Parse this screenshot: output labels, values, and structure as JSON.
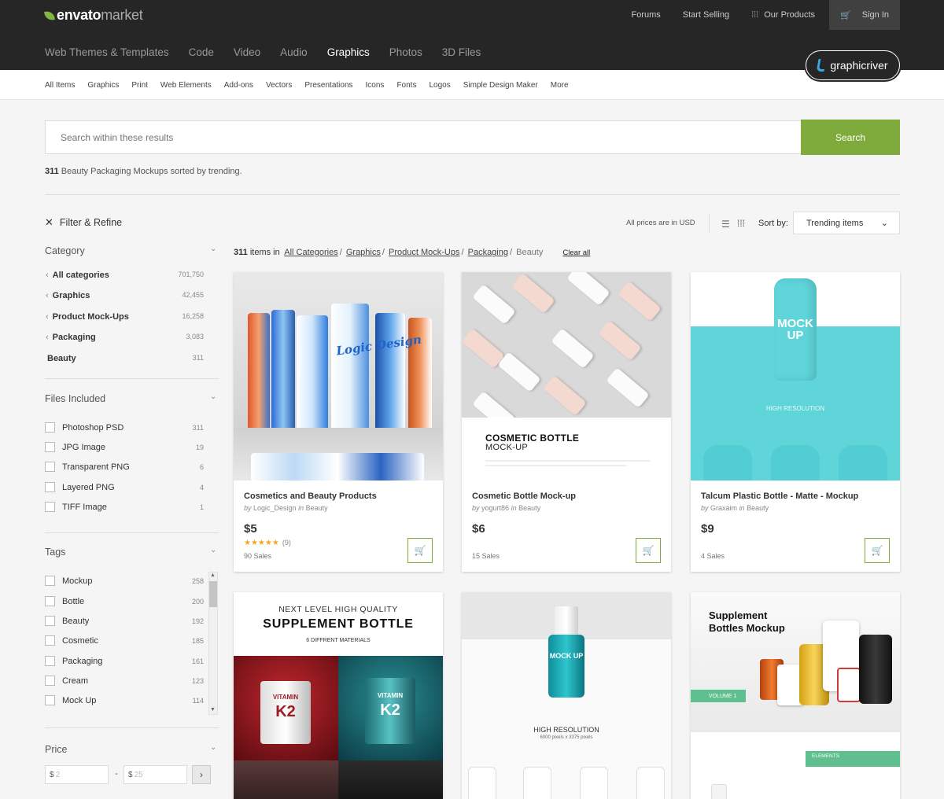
{
  "brand": {
    "word1": "envato",
    "word2": "market"
  },
  "top_links": {
    "forums": "Forums",
    "start_selling": "Start Selling",
    "our_products": "Our Products",
    "sign_in": "Sign In"
  },
  "main_nav": [
    "Web Themes & Templates",
    "Code",
    "Video",
    "Audio",
    "Graphics",
    "Photos",
    "3D Files"
  ],
  "site_badge": "graphicriver",
  "sub_nav": [
    "All Items",
    "Graphics",
    "Print",
    "Web Elements",
    "Add-ons",
    "Vectors",
    "Presentations",
    "Icons",
    "Fonts",
    "Logos",
    "Simple Design Maker",
    "More"
  ],
  "search": {
    "placeholder": "Search within these results",
    "button": "Search"
  },
  "summary": {
    "count": "311",
    "text": " Beauty Packaging Mockups sorted by trending."
  },
  "filter_title": "Filter & Refine",
  "prices_note": "All prices are in USD",
  "sort": {
    "label": "Sort by:",
    "value": "Trending items"
  },
  "sidebar": {
    "category_title": "Category",
    "categories": [
      {
        "label": "All categories",
        "count": "701,750"
      },
      {
        "label": "Graphics",
        "count": "42,455"
      },
      {
        "label": "Product Mock-Ups",
        "count": "16,258"
      },
      {
        "label": "Packaging",
        "count": "3,083"
      },
      {
        "label": "Beauty",
        "count": "311"
      }
    ],
    "files_title": "Files Included",
    "files": [
      {
        "label": "Photoshop PSD",
        "count": "311"
      },
      {
        "label": "JPG Image",
        "count": "19"
      },
      {
        "label": "Transparent PNG",
        "count": "6"
      },
      {
        "label": "Layered PNG",
        "count": "4"
      },
      {
        "label": "TIFF Image",
        "count": "1"
      }
    ],
    "tags_title": "Tags",
    "tags": [
      {
        "label": "Mockup",
        "count": "258"
      },
      {
        "label": "Bottle",
        "count": "200"
      },
      {
        "label": "Beauty",
        "count": "192"
      },
      {
        "label": "Cosmetic",
        "count": "185"
      },
      {
        "label": "Packaging",
        "count": "161"
      },
      {
        "label": "Cream",
        "count": "123"
      },
      {
        "label": "Mock Up",
        "count": "114"
      }
    ],
    "price_title": "Price",
    "price_min": {
      "currency": "$",
      "placeholder": "2"
    },
    "price_max": {
      "currency": "$",
      "placeholder": "25"
    }
  },
  "results": {
    "count": "311",
    "in_label": "items in",
    "crumbs": [
      "All Categories",
      "Graphics",
      "Product Mock-Ups",
      "Packaging"
    ],
    "current": "Beauty",
    "clear": "Clear all"
  },
  "cards": [
    {
      "title": "Cosmetics and Beauty Products",
      "author": "Logic_Design",
      "category": "Beauty",
      "price": "$5",
      "rating_count": "(9)",
      "rating": 5,
      "sales": "90 Sales"
    },
    {
      "title": "Cosmetic Bottle Mock-up",
      "author": "yogurt86",
      "category": "Beauty",
      "price": "$6",
      "sales": "15 Sales"
    },
    {
      "title": "Talcum Plastic Bottle - Matte - Mockup",
      "author": "Graxaim",
      "category": "Beauty",
      "price": "$9",
      "sales": "4 Sales"
    }
  ],
  "thumb_text": {
    "t1_brand": "Logic Design",
    "t2_title": "COSMETIC BOTTLE",
    "t2_sub": "MOCK-UP",
    "t3_mock": "MOCK UP",
    "t3_res": "HIGH RESOLUTION",
    "t4_line1": "NEXT LEVEL HIGH QUALITY",
    "t4_line2": "SUPPLEMENT BOTTLE",
    "t4_line3": "6 DIFFRENT MATERIALS",
    "t4_vitamin": "VITAMIN",
    "t4_k2": "K2",
    "t5_res": "HIGH RESOLUTION",
    "t5_px": "6000 pixels x 3375 pixels",
    "t6_title1": "Supplement",
    "t6_title2": "Bottles Mockup",
    "t6_vol": "VOLUME 1",
    "t6_elements": "ELEMENTS"
  },
  "colors": {
    "accent": "#7fab3c",
    "topbar": "#262626",
    "star": "#f5a623",
    "teal": "#5fd5da"
  }
}
